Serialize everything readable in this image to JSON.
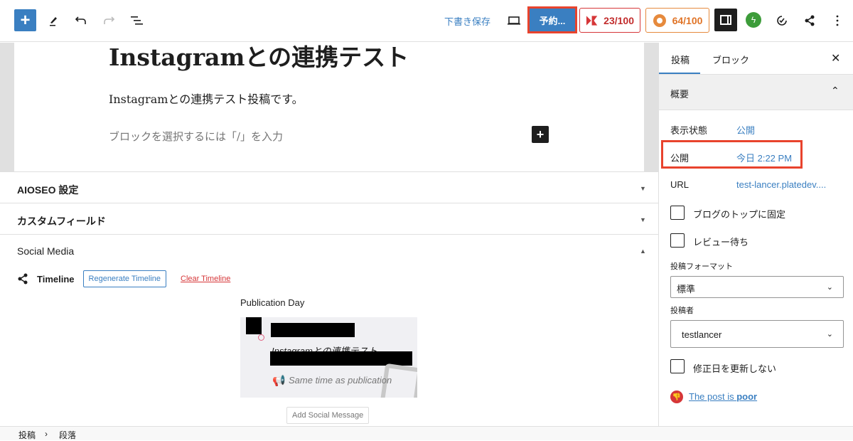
{
  "toolbar": {
    "add_icon": "+",
    "save_draft": "下書き保存",
    "schedule_button": "予約...",
    "score_a": "23/100",
    "score_b": "64/100",
    "jetpack_icon": "ϟ"
  },
  "editor": {
    "title": "Instagramとの連携テスト",
    "paragraph": "Instagramとの連携テスト投稿です。",
    "placeholder": "ブロックを選択するには「/」を入力"
  },
  "panels": {
    "aioseo": "AIOSEO 設定",
    "custom_fields": "カスタムフィールド",
    "social_media": "Social Media"
  },
  "social": {
    "timeline_label": "Timeline",
    "regenerate": "Regenerate Timeline",
    "clear": "Clear Timeline",
    "publication_day": "Publication Day",
    "card_title": "Instagramとの連携テスト",
    "card_time": "Same time as publication",
    "add_message": "Add Social Message"
  },
  "sidebar": {
    "tab_post": "投稿",
    "tab_block": "ブロック",
    "summary": "概要",
    "visibility_label": "表示状態",
    "visibility_value": "公開",
    "publish_label": "公開",
    "publish_value": "今日 2:22 PM",
    "url_label": "URL",
    "url_value": "test-lancer.platedev....",
    "sticky_label": "ブログのトップに固定",
    "pending_label": "レビュー待ち",
    "format_label": "投稿フォーマット",
    "format_value": "標準",
    "author_label": "投稿者",
    "author_value": "testlancer",
    "no_modified_label": "修正日を更新しない",
    "post_quality_prefix": "The post is ",
    "post_quality_value": "poor"
  },
  "breadcrumb": {
    "items": [
      "投稿",
      "段落"
    ],
    "separator": "›"
  }
}
